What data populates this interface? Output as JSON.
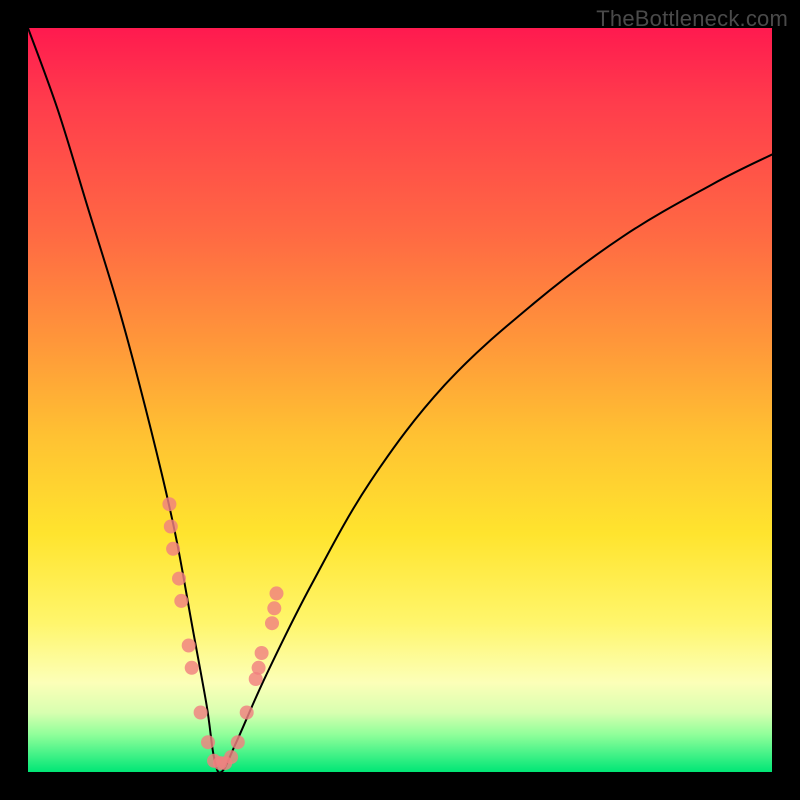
{
  "watermark": "TheBottleneck.com",
  "chart_data": {
    "type": "line",
    "title": "",
    "xlabel": "",
    "ylabel": "",
    "xlim": [
      0,
      100
    ],
    "ylim": [
      0,
      100
    ],
    "background_gradient": {
      "direction": "vertical",
      "stops": [
        {
          "y": 100,
          "color": "#ff1a4f"
        },
        {
          "y": 70,
          "color": "#ff6a43"
        },
        {
          "y": 45,
          "color": "#ffc232"
        },
        {
          "y": 25,
          "color": "#ffe42e"
        },
        {
          "y": 12,
          "color": "#fcffb8"
        },
        {
          "y": 4,
          "color": "#8fff9a"
        },
        {
          "y": 0,
          "color": "#00e676"
        }
      ]
    },
    "series": [
      {
        "name": "bottleneck-curve",
        "stroke": "#000000",
        "stroke_width": 2,
        "x": [
          0,
          4,
          8,
          12,
          15,
          18,
          20,
          22,
          24,
          25,
          26,
          28,
          32,
          38,
          46,
          56,
          68,
          80,
          92,
          100
        ],
        "y": [
          100,
          89,
          76,
          63,
          52,
          40,
          31,
          20,
          9,
          2,
          0,
          4,
          13,
          25,
          39,
          52,
          63,
          72,
          79,
          83
        ]
      }
    ],
    "markers": {
      "name": "highlight-dots",
      "fill": "#f08080",
      "opacity": 0.82,
      "points_xy": [
        [
          19.0,
          36
        ],
        [
          19.2,
          33
        ],
        [
          19.5,
          30
        ],
        [
          20.3,
          26
        ],
        [
          20.6,
          23
        ],
        [
          21.6,
          17
        ],
        [
          22.0,
          14
        ],
        [
          23.2,
          8
        ],
        [
          24.2,
          4
        ],
        [
          25.0,
          1.5
        ],
        [
          25.8,
          1.2
        ],
        [
          26.5,
          1.2
        ],
        [
          27.3,
          2
        ],
        [
          28.2,
          4
        ],
        [
          29.4,
          8
        ],
        [
          30.6,
          12.5
        ],
        [
          31.0,
          14
        ],
        [
          31.4,
          16
        ],
        [
          32.8,
          20
        ],
        [
          33.1,
          22
        ],
        [
          33.4,
          24
        ]
      ],
      "radius": 7
    }
  }
}
